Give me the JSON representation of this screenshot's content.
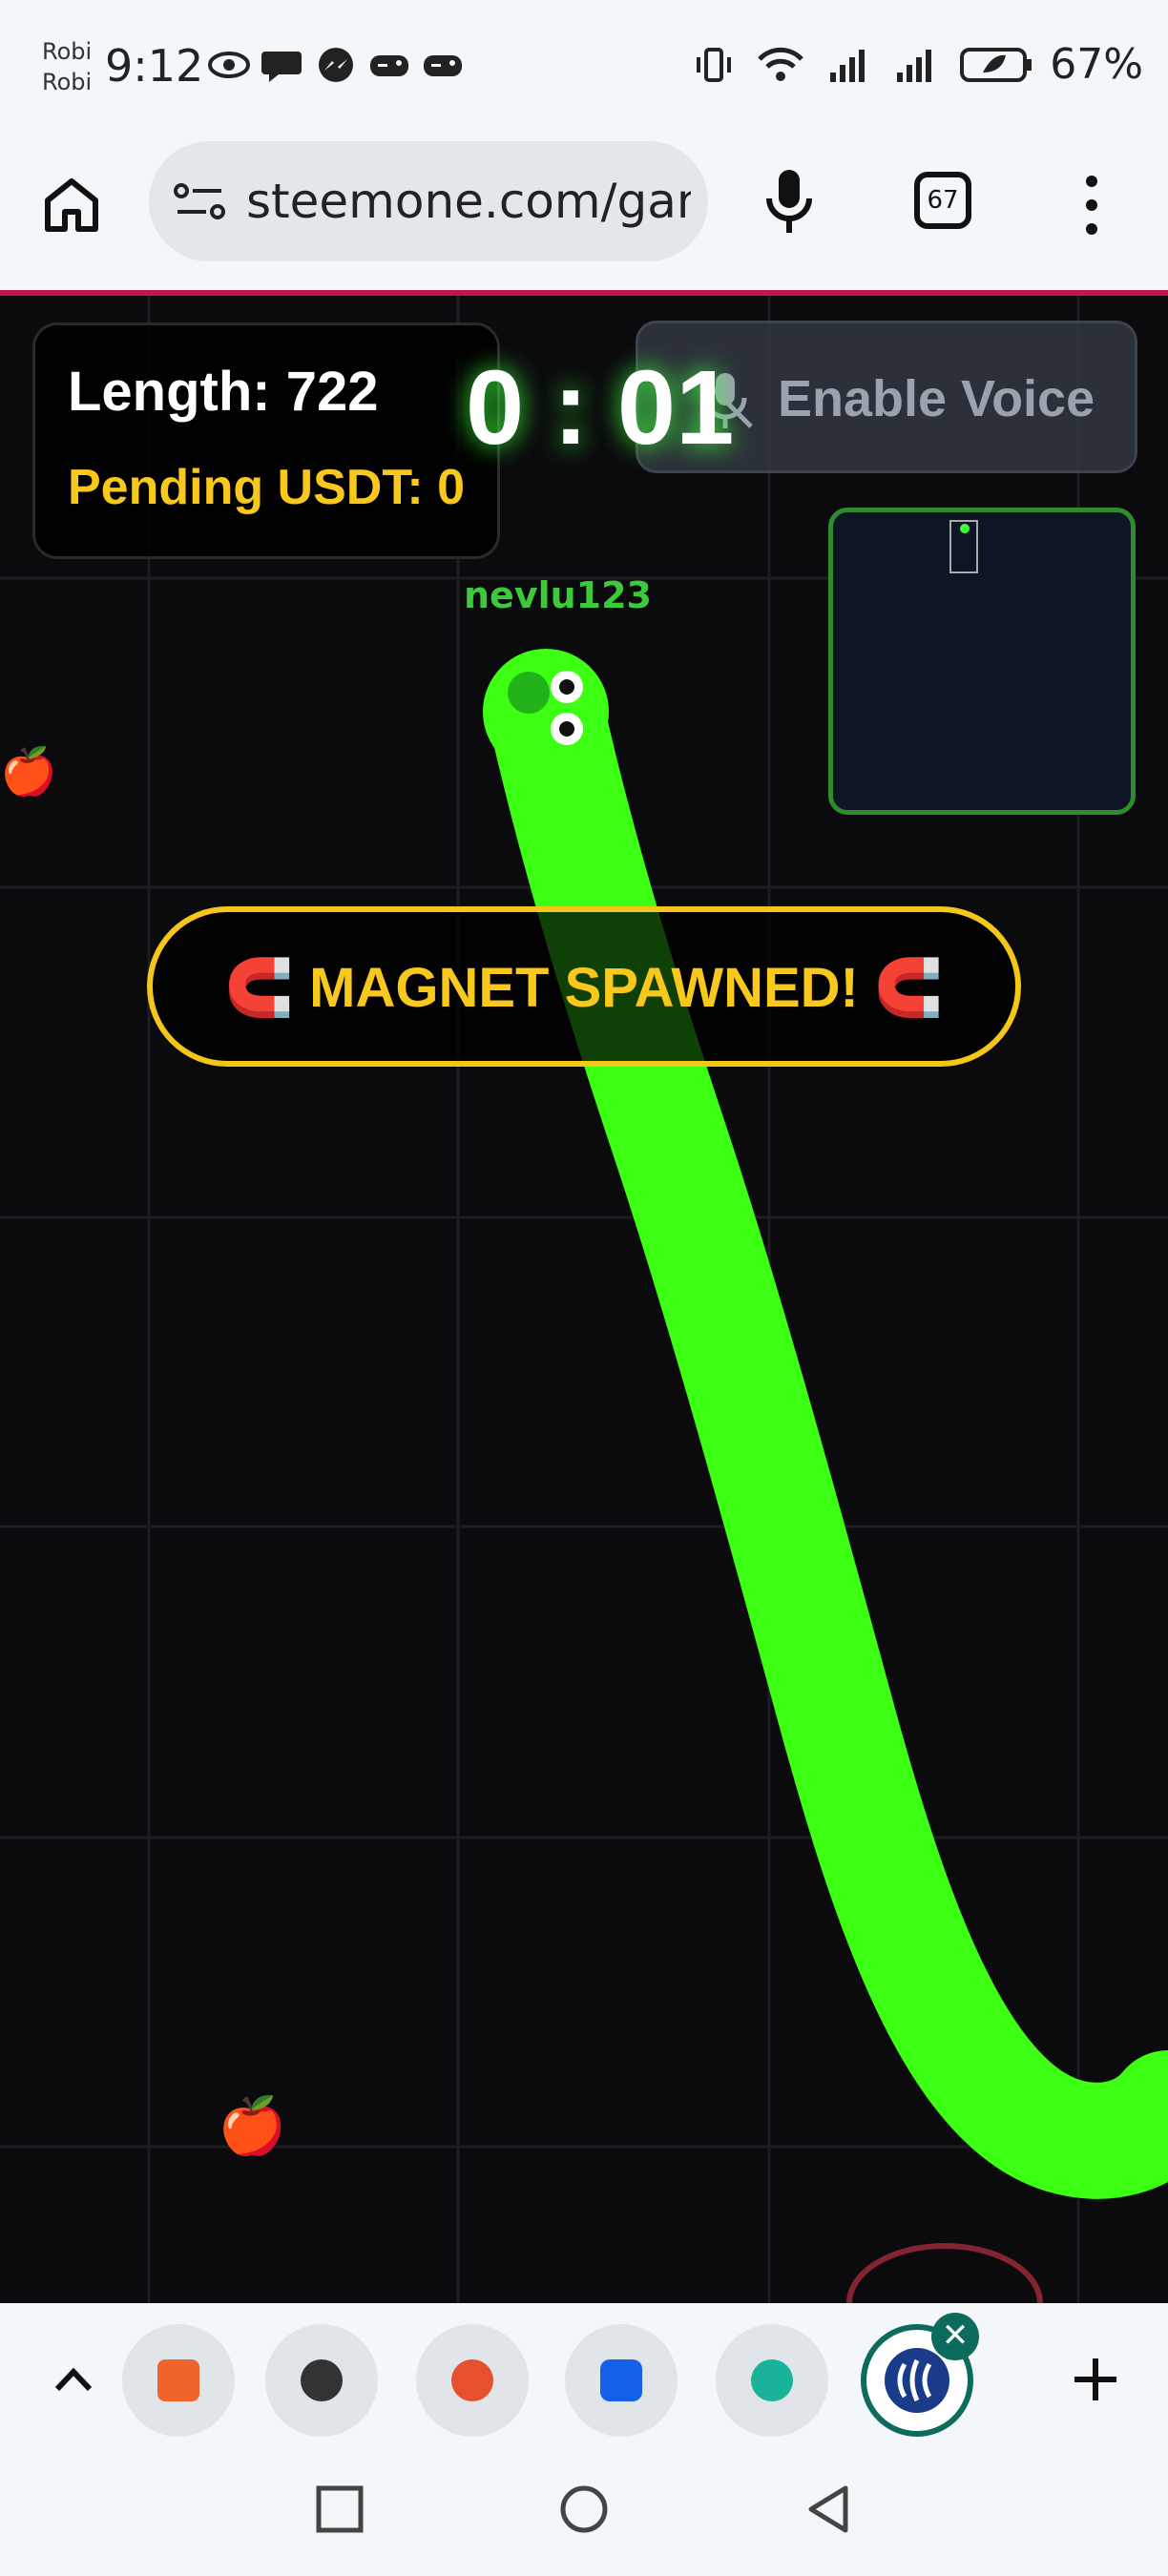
{
  "status_bar": {
    "carrier_line1": "Robi",
    "carrier_line2": "Robi",
    "time": "9:12",
    "battery": "67%",
    "left_icons": [
      "eye-icon",
      "chat-bubble-icon",
      "messenger-icon",
      "game-controller-icon",
      "game-controller-icon"
    ],
    "right_icons": [
      "vibrate-icon",
      "wifi-icon",
      "signal-icon",
      "signal-icon",
      "battery-saver-icon"
    ]
  },
  "browser": {
    "url": "steemone.com/gam",
    "tab_count": "67"
  },
  "game": {
    "length_label": "Length: 722",
    "pending_usdt_label": "Pending USDT: 0",
    "timer": "0 : 01",
    "voice_button_label": "Enable Voice",
    "player_name": "nevlu123",
    "banner_text": "🧲 MAGNET SPAWNED! 🧲",
    "snake_color": "#3cff14",
    "apple_glyph": "🍎"
  },
  "bottom_tabs": {
    "tab_icons": [
      "education-icon",
      "globe-icon",
      "wheel-icon",
      "meta-icon",
      "chat-app-icon",
      "steem-icon"
    ],
    "active_tab": "steem-icon",
    "close_glyph": "✕"
  },
  "colors": {
    "accent": "#c2154d",
    "gold": "#f8c81c",
    "snake": "#3cff14",
    "active_tab": "#0d6b5e"
  }
}
